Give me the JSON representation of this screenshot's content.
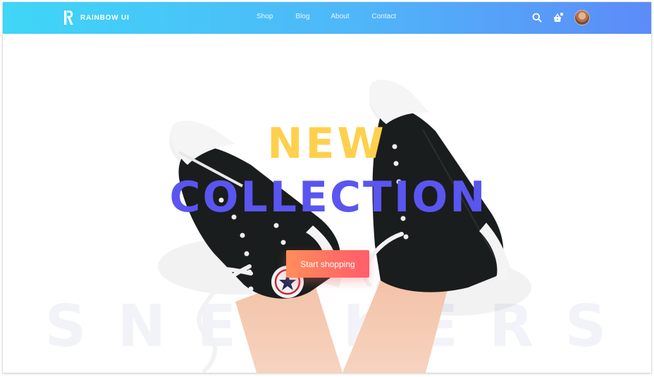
{
  "brand": {
    "name": "RAINBOW UI",
    "logo_icon": "r-logo-icon"
  },
  "nav": {
    "links": [
      {
        "label": "Shop"
      },
      {
        "label": "Blog"
      },
      {
        "label": "About"
      },
      {
        "label": "Contact"
      }
    ],
    "actions": {
      "search_icon": "search-icon",
      "basket_icon": "basket-icon",
      "avatar": "user-avatar"
    }
  },
  "hero": {
    "headline_top": "NEW",
    "headline_bottom": "COLLECTION",
    "background_word": "SNEAKERS",
    "cta_label": "Start shopping"
  },
  "colors": {
    "navbar_gradient_start": "#3fd6f7",
    "navbar_gradient_end": "#5d8bf8",
    "headline_top": "#ffd04d",
    "headline_bottom": "#5a55f0",
    "cta_gradient_start": "#ff8e5a",
    "cta_gradient_end": "#ff5e6a",
    "background_word": "#f2f3f8"
  }
}
